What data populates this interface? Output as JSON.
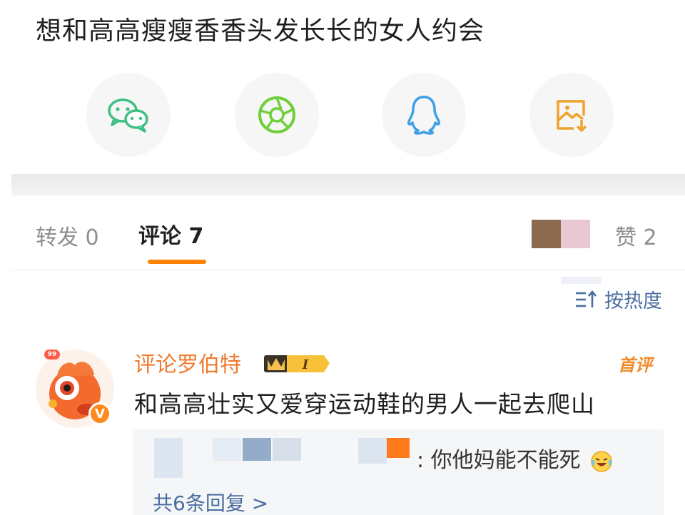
{
  "post": {
    "text": "想和高高瘦瘦香香头发长长的女人约会"
  },
  "share": {
    "buttons": [
      {
        "name": "wechat",
        "icon": "wechat-icon",
        "color": "#3ebf83"
      },
      {
        "name": "moments",
        "icon": "moments-aperture-icon",
        "color": "#6fcf3a"
      },
      {
        "name": "qq",
        "icon": "qq-penguin-icon",
        "color": "#3fa0e6"
      },
      {
        "name": "save-image",
        "icon": "save-image-icon",
        "color": "#f0a22e"
      }
    ]
  },
  "tabs": {
    "repost": "转发 0",
    "comment": "评论 7",
    "like": "赞 2",
    "accent": "#ff8200"
  },
  "sort": {
    "label": "按热度",
    "icon": "sort-icon"
  },
  "comment": {
    "username": "评论罗伯特",
    "level_badge": "I",
    "first_tag": "首评",
    "text": "和高高壮实又爱穿运动鞋的男人一起去爬山",
    "reply": {
      "text": ": 你他妈能不能死",
      "emoji": "laughing-crying-emoji-icon"
    },
    "reply_count": "共6条回复 >",
    "username_color": "#f07a2e",
    "link_color": "#4a6ea0"
  }
}
